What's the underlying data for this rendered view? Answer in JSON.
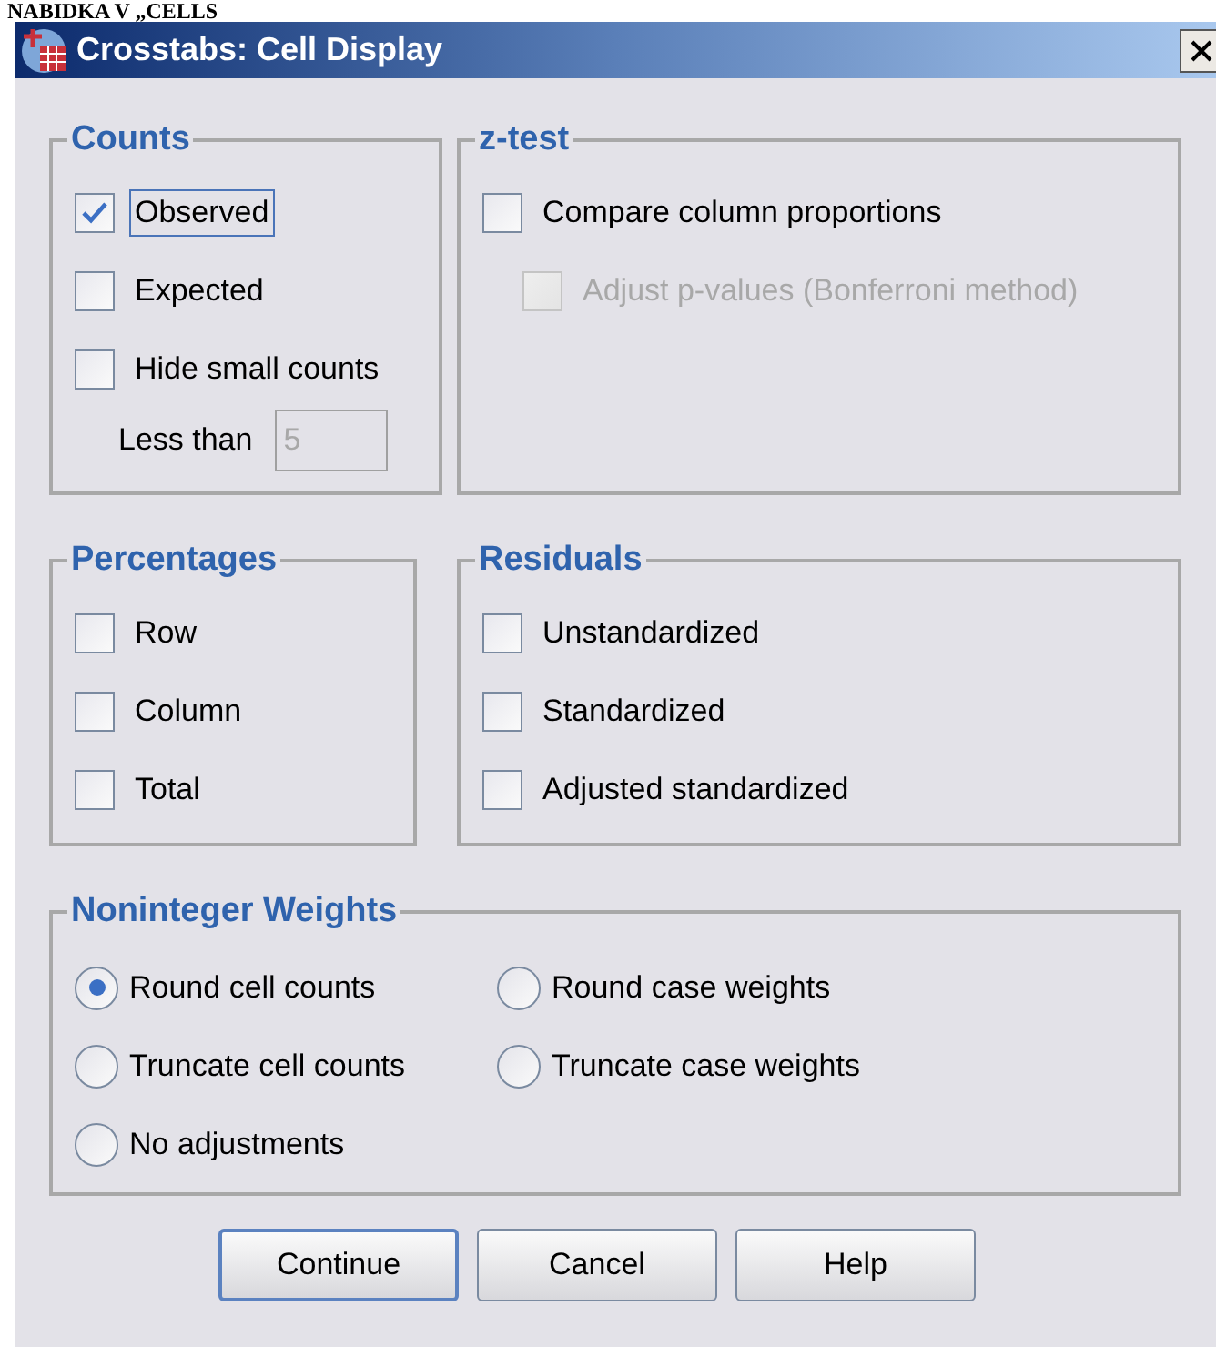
{
  "page_heading": "NABIDKA V „CELLS",
  "window": {
    "title": "Crosstabs: Cell Display"
  },
  "groups": [
    {
      "title": "Counts",
      "items": [
        {
          "kind": "checkbox",
          "label": "Observed",
          "checked": true,
          "disabled": false,
          "focused": true
        },
        {
          "kind": "checkbox",
          "label": "Expected",
          "checked": false,
          "disabled": false,
          "focused": false
        },
        {
          "kind": "checkbox",
          "label": "Hide small counts",
          "checked": false,
          "disabled": false,
          "focused": false
        },
        {
          "kind": "number",
          "label": "Less than",
          "value": "5",
          "disabled": true
        }
      ]
    },
    {
      "title": "z-test",
      "items": [
        {
          "kind": "checkbox",
          "label": "Compare column proportions",
          "checked": false,
          "disabled": false,
          "focused": false
        },
        {
          "kind": "subcheckbox",
          "label": "Adjust p-values (Bonferroni method)",
          "checked": false,
          "disabled": true,
          "focused": false
        }
      ]
    },
    {
      "title": "Percentages",
      "items": [
        {
          "kind": "checkbox",
          "label": "Row",
          "checked": false,
          "disabled": false,
          "focused": false
        },
        {
          "kind": "checkbox",
          "label": "Column",
          "checked": false,
          "disabled": false,
          "focused": false
        },
        {
          "kind": "checkbox",
          "label": "Total",
          "checked": false,
          "disabled": false,
          "focused": false
        }
      ]
    },
    {
      "title": "Residuals",
      "items": [
        {
          "kind": "checkbox",
          "label": "Unstandardized",
          "checked": false,
          "disabled": false,
          "focused": false
        },
        {
          "kind": "checkbox",
          "label": "Standardized",
          "checked": false,
          "disabled": false,
          "focused": false
        },
        {
          "kind": "checkbox",
          "label": "Adjusted standardized",
          "checked": false,
          "disabled": false,
          "focused": false
        }
      ]
    }
  ],
  "weights": {
    "title": "Noninteger Weights",
    "options": [
      {
        "label": "Round cell counts",
        "selected": true
      },
      {
        "label": "Round case weights",
        "selected": false
      },
      {
        "label": "Truncate cell counts",
        "selected": false
      },
      {
        "label": "Truncate case weights",
        "selected": false
      },
      {
        "label": "No adjustments",
        "selected": false
      }
    ]
  },
  "buttons": [
    {
      "label": "Continue",
      "default": true
    },
    {
      "label": "Cancel",
      "default": false
    },
    {
      "label": "Help",
      "default": false
    }
  ]
}
